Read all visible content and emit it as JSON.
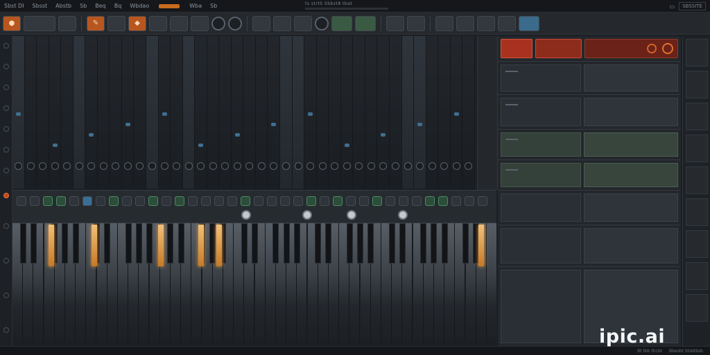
{
  "menubar": {
    "items": [
      "Sbst DI",
      "Sbsst",
      "Abstb",
      "Sb",
      "Beq",
      "Bq",
      "Wbdao",
      "Wba",
      "Sb",
      "SD"
    ],
    "title": "ts strtS Sbbzt8 tbat",
    "brand": "SBSSITE"
  },
  "toolbar": {
    "buttons": [
      "tool-1",
      "tool-2",
      "tool-3",
      "tool-4",
      "tool-5"
    ]
  },
  "watermark": "ipic.ai",
  "statusbar": {
    "left_text": "Bt tbb thcbt",
    "right_text": "Bbesbt Stsbtbsb"
  },
  "colors": {
    "accent": "#c86a1c",
    "panel_red": "#a8321f",
    "key_glow": "#e59a42",
    "green": "#3b5a44",
    "blue": "#3a6b8a"
  }
}
